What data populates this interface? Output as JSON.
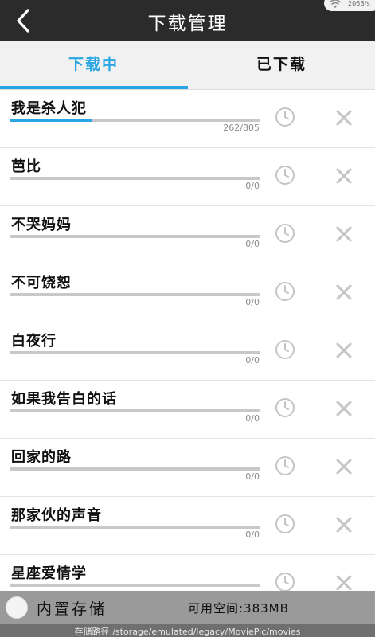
{
  "header": {
    "title": "下载管理",
    "status_speed": "206B/s"
  },
  "tabs": [
    {
      "label": "下载中",
      "active": true
    },
    {
      "label": "已下载",
      "active": false
    }
  ],
  "downloads": [
    {
      "title": "我是杀人犯",
      "count": "262/805",
      "progress": 0.325
    },
    {
      "title": "芭比",
      "count": "0/0",
      "progress": 0
    },
    {
      "title": "不哭妈妈",
      "count": "0/0",
      "progress": 0
    },
    {
      "title": "不可饶恕",
      "count": "0/0",
      "progress": 0
    },
    {
      "title": "白夜行",
      "count": "0/0",
      "progress": 0
    },
    {
      "title": "如果我告白的话",
      "count": "0/0",
      "progress": 0
    },
    {
      "title": "回家的路",
      "count": "0/0",
      "progress": 0
    },
    {
      "title": "那家伙的声音",
      "count": "0/0",
      "progress": 0
    },
    {
      "title": "星座爱情学",
      "count": "",
      "progress": 0
    }
  ],
  "footer": {
    "storage_label": "内置存储",
    "free_space": "可用空间:383MB",
    "path": "存储路径:/storage/emulated/legacy/MoviePic/movies"
  },
  "colors": {
    "accent": "#29a6e3",
    "topbar": "#2b2b2b",
    "tabs_bg": "#f1f1f1",
    "footer_bg": "#9a9a9a",
    "path_bg": "#6f6f6f"
  }
}
